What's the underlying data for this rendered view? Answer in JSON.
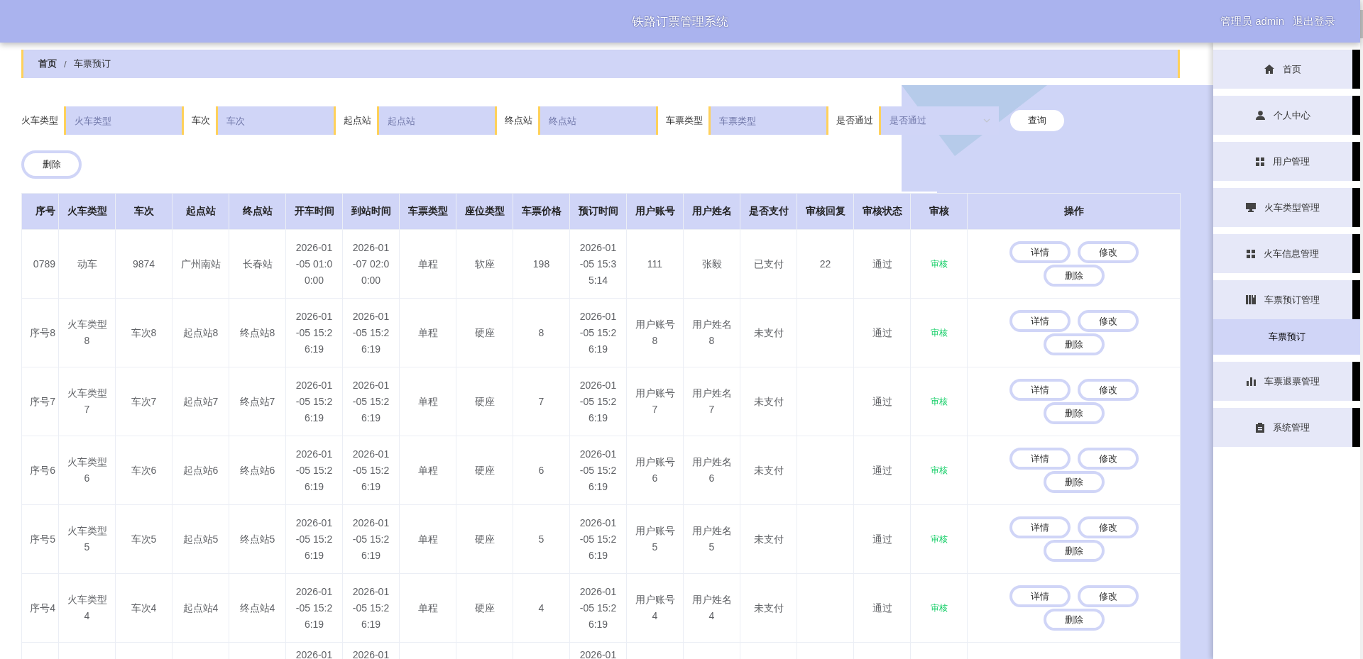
{
  "header": {
    "title": "铁路订票管理系统",
    "user": "管理员 admin",
    "logout": "退出登录"
  },
  "breadcrumb": {
    "items": [
      "首页",
      "车票预订"
    ],
    "separator": "/"
  },
  "filters": [
    {
      "kind": "input",
      "label": "火车类型",
      "placeholder": "火车类型"
    },
    {
      "kind": "input",
      "label": "车次",
      "placeholder": "车次"
    },
    {
      "kind": "input",
      "label": "起点站",
      "placeholder": "起点站"
    },
    {
      "kind": "input",
      "label": "终点站",
      "placeholder": "终点站"
    },
    {
      "kind": "input",
      "label": "车票类型",
      "placeholder": "车票类型"
    },
    {
      "kind": "select",
      "label": "是否通过",
      "placeholder": "是否通过"
    }
  ],
  "search_button": "查询",
  "delete_button": "删除",
  "table": {
    "columns": [
      "序号",
      "火车类型",
      "车次",
      "起点站",
      "终点站",
      "开车时间",
      "到站时间",
      "车票类型",
      "座位类型",
      "车票价格",
      "预订时间",
      "用户账号",
      "用户姓名",
      "是否支付",
      "审核回复",
      "审核状态",
      "审核",
      "操作"
    ],
    "rows": [
      {
        "no": "0789",
        "train_type": "动车",
        "train_no": "9874",
        "from": "广州南站",
        "to": "长春站",
        "depart": "2026-01-05 01:00:00",
        "arrive": "2026-01-07 02:00:00",
        "ticket_type": "单程",
        "seat_type": "软座",
        "price": "198",
        "booked_at": "2026-01-05 15:35:14",
        "account": "111",
        "user_name": "张毅",
        "paid": "已支付",
        "reply": "22",
        "status": "通过",
        "review": "审核",
        "actions": [
          "详情",
          "修改",
          "删除"
        ]
      },
      {
        "no": "序号8",
        "train_type": "火车类型8",
        "train_no": "车次8",
        "from": "起点站8",
        "to": "终点站8",
        "depart": "2026-01-05 15:26:19",
        "arrive": "2026-01-05 15:26:19",
        "ticket_type": "单程",
        "seat_type": "硬座",
        "price": "8",
        "booked_at": "2026-01-05 15:26:19",
        "account": "用户账号8",
        "user_name": "用户姓名8",
        "paid": "未支付",
        "status": "通过",
        "review": "审核",
        "actions": [
          "详情",
          "修改",
          "删除"
        ]
      },
      {
        "no": "序号7",
        "train_type": "火车类型7",
        "train_no": "车次7",
        "from": "起点站7",
        "to": "终点站7",
        "depart": "2026-01-05 15:26:19",
        "arrive": "2026-01-05 15:26:19",
        "ticket_type": "单程",
        "seat_type": "硬座",
        "price": "7",
        "booked_at": "2026-01-05 15:26:19",
        "account": "用户账号7",
        "user_name": "用户姓名7",
        "paid": "未支付",
        "status": "通过",
        "review": "审核",
        "actions": [
          "详情",
          "修改",
          "删除"
        ]
      },
      {
        "no": "序号6",
        "train_type": "火车类型6",
        "train_no": "车次6",
        "from": "起点站6",
        "to": "终点站6",
        "depart": "2026-01-05 15:26:19",
        "arrive": "2026-01-05 15:26:19",
        "ticket_type": "单程",
        "seat_type": "硬座",
        "price": "6",
        "booked_at": "2026-01-05 15:26:19",
        "account": "用户账号6",
        "user_name": "用户姓名6",
        "paid": "未支付",
        "status": "通过",
        "review": "审核",
        "actions": [
          "详情",
          "修改",
          "删除"
        ]
      },
      {
        "no": "序号5",
        "train_type": "火车类型5",
        "train_no": "车次5",
        "from": "起点站5",
        "to": "终点站5",
        "depart": "2026-01-05 15:26:19",
        "arrive": "2026-01-05 15:26:19",
        "ticket_type": "单程",
        "seat_type": "硬座",
        "price": "5",
        "booked_at": "2026-01-05 15:26:19",
        "account": "用户账号5",
        "user_name": "用户姓名5",
        "paid": "未支付",
        "status": "通过",
        "review": "审核",
        "actions": [
          "详情",
          "修改",
          "删除"
        ]
      },
      {
        "no": "序号4",
        "train_type": "火车类型4",
        "train_no": "车次4",
        "from": "起点站4",
        "to": "终点站4",
        "depart": "2026-01-05 15:26:19",
        "arrive": "2026-01-05 15:26:19",
        "ticket_type": "单程",
        "seat_type": "硬座",
        "price": "4",
        "booked_at": "2026-01-05 15:26:19",
        "account": "用户账号4",
        "user_name": "用户姓名4",
        "paid": "未支付",
        "status": "通过",
        "review": "审核",
        "actions": [
          "详情",
          "修改",
          "删除"
        ]
      }
    ],
    "partial_row": {
      "depart": "2026-01",
      "arrive": "2026-01",
      "booked_at": "2026-01"
    }
  },
  "sidebar": {
    "items": [
      {
        "kind": "menu",
        "label": "首页",
        "selected": false
      },
      {
        "kind": "menu",
        "label": "个人中心",
        "selected": false
      },
      {
        "kind": "menu",
        "label": "用户管理",
        "selected": false
      },
      {
        "kind": "menu",
        "label": "火车类型管理",
        "selected": false
      },
      {
        "kind": "menu",
        "label": "火车信息管理",
        "selected": false
      },
      {
        "kind": "menu",
        "label": "车票预订管理",
        "selected": false
      },
      {
        "kind": "submenu",
        "label": "车票预订",
        "selected": true
      },
      {
        "kind": "menu",
        "label": "车票退票管理",
        "selected": false
      },
      {
        "kind": "menu",
        "label": "系统管理",
        "selected": false
      }
    ]
  }
}
